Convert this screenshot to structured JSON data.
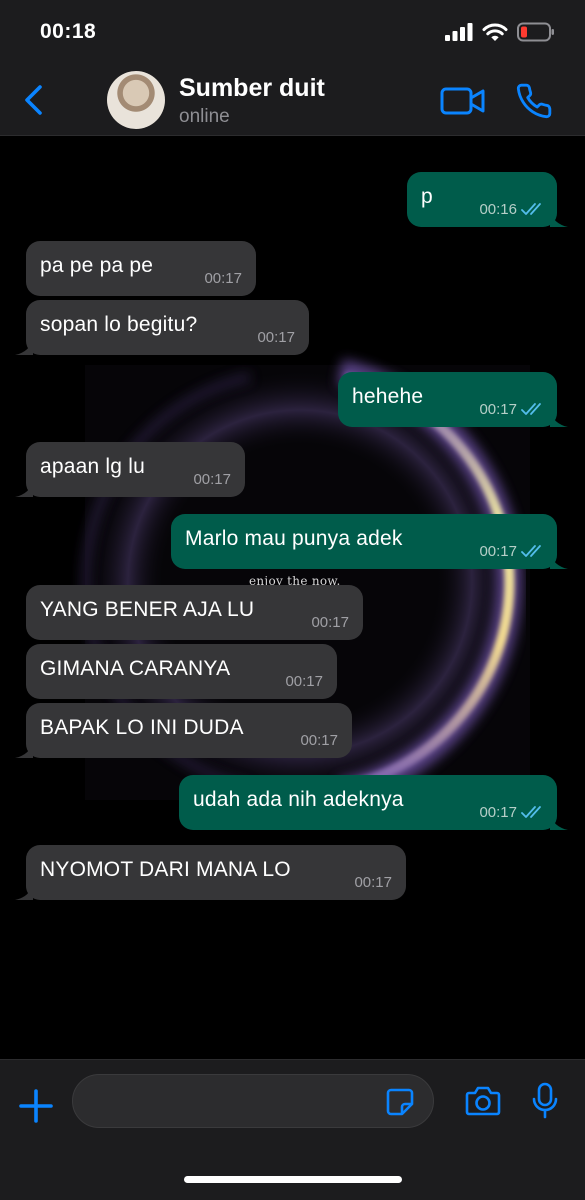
{
  "status_bar": {
    "time": "00:18"
  },
  "header": {
    "contact_name": "Sumber duit",
    "contact_status": "online"
  },
  "wallpaper": {
    "caption": "enjoy the now."
  },
  "messages": [
    {
      "direction": "out",
      "text": "p",
      "time": "00:16",
      "read": true
    },
    {
      "direction": "in",
      "text": "pa pe pa pe",
      "time": "00:17"
    },
    {
      "direction": "in",
      "text": "sopan lo begitu?",
      "time": "00:17"
    },
    {
      "direction": "out",
      "text": "hehehe",
      "time": "00:17",
      "read": true
    },
    {
      "direction": "in",
      "text": "apaan lg lu",
      "time": "00:17"
    },
    {
      "direction": "out",
      "text": "Marlo mau punya adek",
      "time": "00:17",
      "read": true
    },
    {
      "direction": "in",
      "text": "YANG BENER AJA LU",
      "time": "00:17"
    },
    {
      "direction": "in",
      "text": "GIMANA CARANYA",
      "time": "00:17"
    },
    {
      "direction": "in",
      "text": "BAPAK LO INI DUDA",
      "time": "00:17"
    },
    {
      "direction": "out",
      "text": "udah ada nih adeknya",
      "time": "00:17",
      "read": true
    },
    {
      "direction": "in",
      "text": "NYOMOT DARI MANA LO",
      "time": "00:17"
    }
  ],
  "input": {
    "value": "",
    "placeholder": ""
  },
  "colors": {
    "accent": "#0a84ff",
    "outgoing_bubble": "#005c4b",
    "incoming_bubble": "#363638",
    "read_ticks": "#53bdeb",
    "battery_low": "#ff3b30"
  }
}
